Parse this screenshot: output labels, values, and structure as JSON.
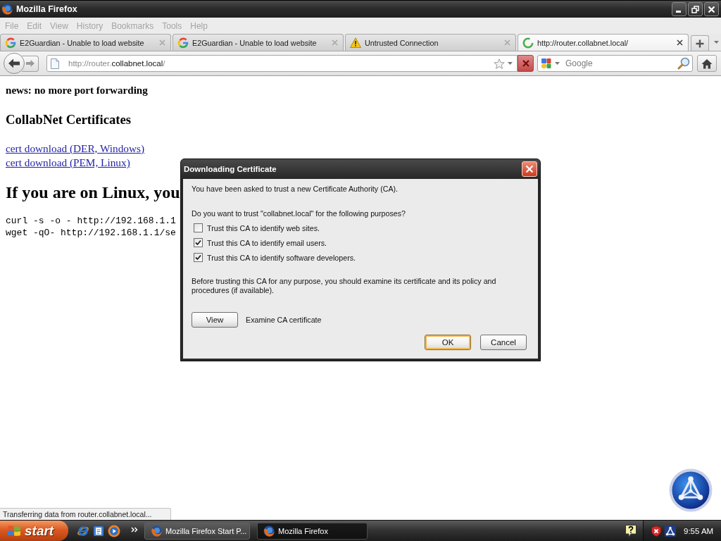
{
  "window": {
    "title": "Mozilla Firefox"
  },
  "menu": [
    "File",
    "Edit",
    "View",
    "History",
    "Bookmarks",
    "Tools",
    "Help"
  ],
  "tabs": [
    {
      "label": "E2Guardian - Unable to load website",
      "kind": "favicon",
      "selected": false
    },
    {
      "label": "E2Guardian - Unable to load website",
      "kind": "favicon",
      "selected": false
    },
    {
      "label": "Untrusted Connection",
      "kind": "warning",
      "selected": false
    },
    {
      "label": "http://router.collabnet.local/",
      "kind": "loading",
      "selected": true
    }
  ],
  "navigation": {
    "url": [
      {
        "text": "http://router.",
        "highlight": false
      },
      {
        "text": "collabnet.local",
        "highlight": true
      },
      {
        "text": "/",
        "highlight": false
      }
    ],
    "search": {
      "placeholder": "Google"
    }
  },
  "page": {
    "news": "news: no more port forwarding",
    "heading": "CollabNet Certificates",
    "links": [
      "cert download (DER, Windows)",
      "cert download (PEM, Linux)"
    ],
    "linux_heading": "If you are on Linux, you",
    "commands": [
      "curl -s -o - http://192.168.1.1",
      "wget -qO- http://192.168.1.1/se"
    ]
  },
  "status_bar": "Transferring data from router.collabnet.local...",
  "dialog": {
    "title": "Downloading Certificate",
    "intro": "You have been asked to trust a new Certificate Authority (CA).",
    "question": "Do you want to trust \"collabnet.local\" for the following purposes?",
    "purposes": [
      {
        "label": "Trust this CA to identify web sites.",
        "checked": false
      },
      {
        "label": "Trust this CA to identify email users.",
        "checked": true
      },
      {
        "label": "Trust this CA to identify software developers.",
        "checked": true
      }
    ],
    "note": "Before trusting this CA for any purpose, you should examine its certificate and its policy and procedures (if available).",
    "view": {
      "button": "View",
      "label": "Examine CA certificate"
    },
    "buttons": [
      {
        "label": "OK",
        "focused": true
      },
      {
        "label": "Cancel",
        "focused": false
      }
    ]
  },
  "taskbar": {
    "start": "start",
    "tasks": [
      {
        "label": "Mozilla Firefox Start P...",
        "selected": false
      },
      {
        "label": "Mozilla Firefox",
        "selected": true
      }
    ],
    "clock": "9:55 AM"
  }
}
